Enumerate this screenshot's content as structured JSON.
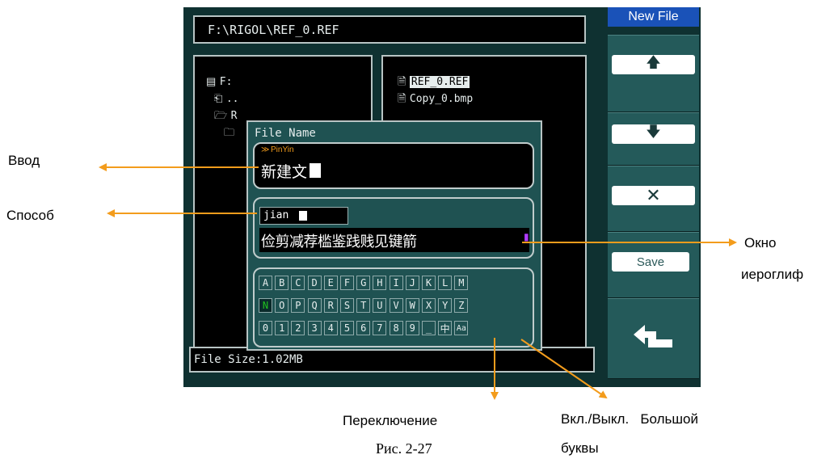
{
  "path": "F:\\RIGOL\\REF_0.REF",
  "dir_tree": [
    "F:",
    "..",
    "R",
    ""
  ],
  "files": [
    "REF_0.REF",
    "Copy_0.bmp"
  ],
  "file_size": "File Size:1.02MB",
  "menu": {
    "title": "New File",
    "save": "Save"
  },
  "dialog": {
    "title": "File Name",
    "mode": "PinYin",
    "input_text": "新建文",
    "pinyin": "jian",
    "candidates": "俭剪减荐槛鉴践贱见键箭",
    "keys_row1": [
      "A",
      "B",
      "C",
      "D",
      "E",
      "F",
      "G",
      "H",
      "I",
      "J",
      "K",
      "L",
      "M"
    ],
    "keys_row2": [
      "N",
      "O",
      "P",
      "Q",
      "R",
      "S",
      "T",
      "U",
      "V",
      "W",
      "X",
      "Y",
      "Z"
    ],
    "keys_row3": [
      "0",
      "1",
      "2",
      "3",
      "4",
      "5",
      "6",
      "7",
      "8",
      "9",
      "_",
      "中",
      "Aa"
    ]
  },
  "annotations": {
    "input": "Ввод",
    "method": "Способ",
    "window1": "Окно",
    "window2": "иероглиф",
    "switch": "Переключение",
    "caps1": "Вкл./Выкл.   Большой",
    "caps2": "буквы",
    "figure": "Рис. 2-27"
  },
  "colors": {
    "accent": "#f39c1c",
    "title_bar": "#1a52b8",
    "selected_key": "#20c020"
  }
}
